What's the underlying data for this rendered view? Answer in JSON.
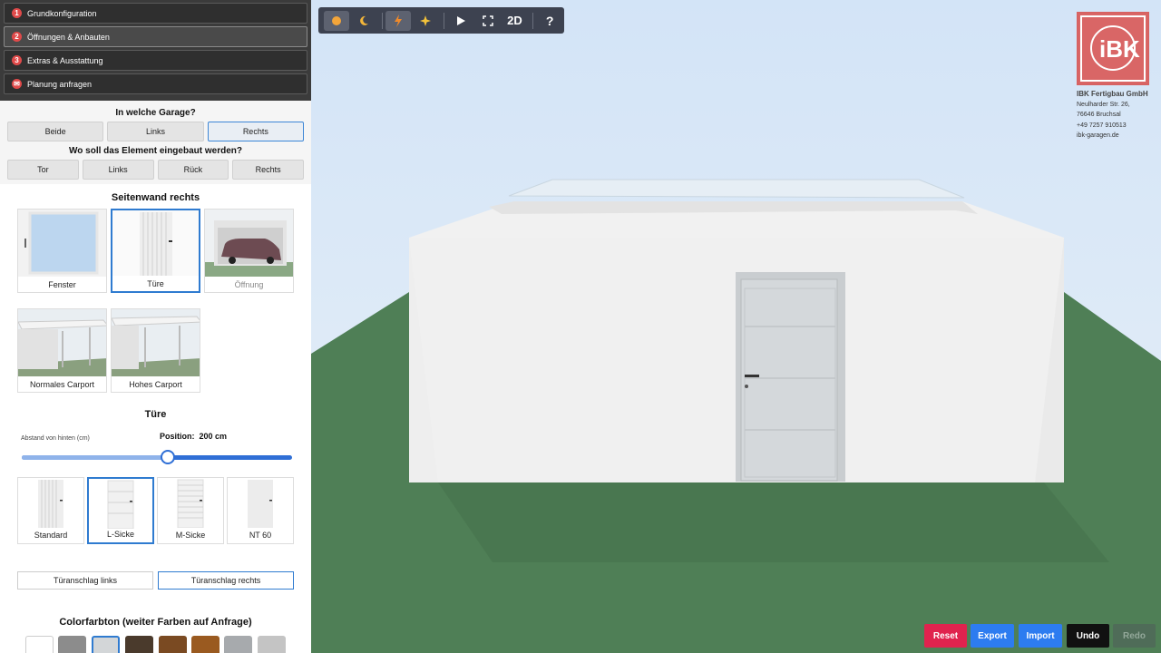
{
  "steps": [
    {
      "num": "1",
      "label": "Grundkonfiguration"
    },
    {
      "num": "2",
      "label": "Öffnungen & Anbauten"
    },
    {
      "num": "3",
      "label": "Extras & Ausstattung"
    },
    {
      "num": "✉",
      "label": "Planung anfragen"
    }
  ],
  "garage_question": "In welche Garage?",
  "garage_options": [
    "Beide",
    "Links",
    "Rechts"
  ],
  "element_question": "Wo soll das Element eingebaut werden?",
  "element_options": [
    "Tor",
    "Links",
    "Rück",
    "Rechts"
  ],
  "wall_title": "Seitenwand rechts",
  "element_cards": [
    "Fenster",
    "Türe",
    "Öffnung",
    "Normales Carport",
    "Hohes Carport"
  ],
  "door_title": "Türe",
  "slider": {
    "label": "Abstand von hinten (cm)",
    "position_label": "Position:",
    "position_value": "200 cm"
  },
  "door_types": [
    "Standard",
    "L-Sicke",
    "M-Sicke",
    "NT 60"
  ],
  "hinge": [
    "Türanschlag links",
    "Türanschlag rechts"
  ],
  "color_title": "Colorfarbton (weiter Farben auf Anfrage)",
  "colors": [
    "#ffffff",
    "#8c8c8c",
    "#d3d6d8",
    "#4a3a2c",
    "#7a4a22",
    "#9a5a20",
    "#a7aaad",
    "#c4c4c4"
  ],
  "toolbar": {
    "btn_2d": "2D",
    "btn_help": "?"
  },
  "company": {
    "name": "IBK Fertigbau GmbH",
    "street": "Neulharder Str. 26,",
    "city": "76646 Bruchsal",
    "phone": "+49 7257 910513",
    "web": "ibk-garagen.de"
  },
  "actions": [
    {
      "label": "Reset",
      "color": "#e0234e"
    },
    {
      "label": "Export",
      "color": "#2d7cf0"
    },
    {
      "label": "Import",
      "color": "#2d7cf0"
    },
    {
      "label": "Undo",
      "color": "#111111"
    },
    {
      "label": "Redo",
      "color": "#4f6c58"
    }
  ],
  "colors_ui": {
    "sky": "#dce9f6",
    "ground": "#4f7f56",
    "accent": "#2f7bd0"
  }
}
